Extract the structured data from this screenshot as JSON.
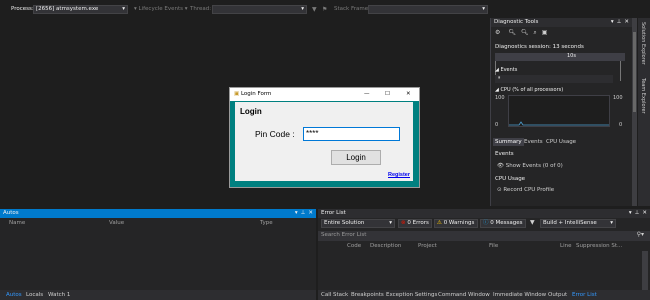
{
  "toolbar": {
    "process_label": "Process:",
    "process_value": "[2656] atmsystem.exe",
    "lifecycle_label": "Lifecycle Events",
    "thread_label": "Thread:",
    "stackframe_label": "Stack Frame:"
  },
  "diag": {
    "title": "Diagnostic Tools",
    "session": "Diagnostics session: 13 seconds",
    "ruler_label": "10s",
    "events_label": "Events",
    "cpu_label": "CPU (% of all processors)",
    "y_max_left": "100",
    "y_min_left": "0",
    "y_max_right": "100",
    "y_min_right": "0",
    "tabs": [
      "Summary",
      "Events",
      "CPU Usage"
    ],
    "events_heading": "Events",
    "show_events": "Show Events (0 of 0)",
    "cpu_heading": "CPU Usage",
    "record_profile": "Record CPU Profile"
  },
  "side_tabs": [
    "Solution Explorer",
    "Team Explorer"
  ],
  "login": {
    "window_title": "Login Form",
    "heading": "Login",
    "pin_label": "Pin Code :",
    "pin_value": "****",
    "button": "Login",
    "register": "Register"
  },
  "autos": {
    "title": "Autos",
    "columns": [
      "Name",
      "Value",
      "Type"
    ],
    "tabs": [
      "Autos",
      "Locals",
      "Watch 1"
    ]
  },
  "errors": {
    "title": "Error List",
    "scope": "Entire Solution",
    "errors_btn": "0 Errors",
    "warnings_btn": "0 Warnings",
    "messages_btn": "0 Messages",
    "build_filter": "Build + IntelliSense",
    "search_placeholder": "Search Error List",
    "columns": [
      "Code",
      "Description",
      "Project",
      "File",
      "Line",
      "Suppression St..."
    ],
    "tabs": [
      "Call Stack",
      "Breakpoints",
      "Exception Settings",
      "Command Window",
      "Immediate Window",
      "Output",
      "Error List"
    ]
  }
}
